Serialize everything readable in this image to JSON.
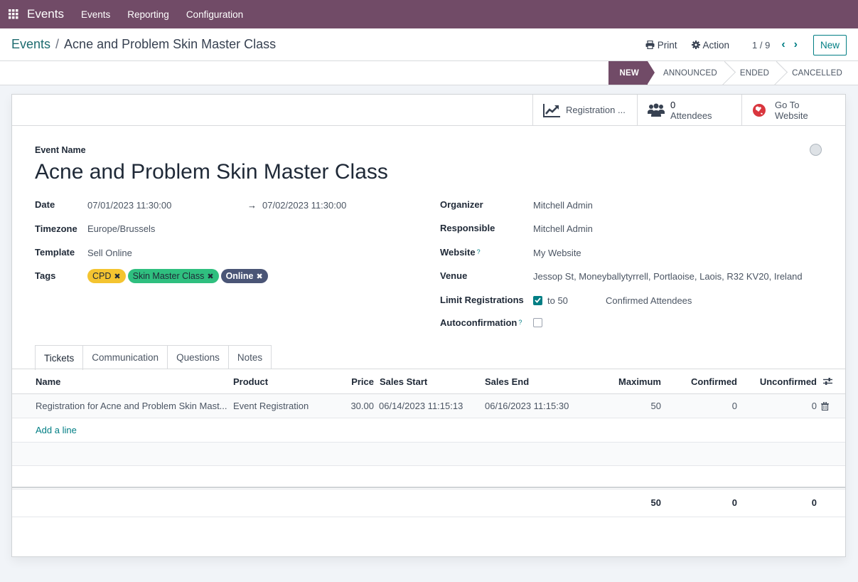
{
  "topnav": {
    "app_name": "Events",
    "menus": [
      "Events",
      "Reporting",
      "Configuration"
    ]
  },
  "control": {
    "breadcrumb_parent": "Events",
    "breadcrumb_separator": "/",
    "breadcrumb_current": "Acne and Problem Skin Master Class",
    "print_label": "Print",
    "action_label": "Action",
    "pager": "1 / 9",
    "new_label": "New"
  },
  "status": {
    "stages": [
      "NEW",
      "ANNOUNCED",
      "ENDED",
      "CANCELLED"
    ],
    "active": "NEW"
  },
  "smart_buttons": {
    "registration_label": "Registration ...",
    "attendees_count": "0",
    "attendees_label": "Attendees",
    "website_line1": "Go To",
    "website_line2": "Website"
  },
  "form": {
    "event_name_label": "Event Name",
    "event_name": "Acne and Problem Skin Master Class",
    "date_label": "Date",
    "date_start": "07/01/2023 11:30:00",
    "date_arrow": "→",
    "date_end": "07/02/2023 11:30:00",
    "timezone_label": "Timezone",
    "timezone": "Europe/Brussels",
    "template_label": "Template",
    "template": "Sell Online",
    "tags_label": "Tags",
    "tags": [
      {
        "label": "CPD",
        "color": "#f4c430",
        "text_color": "#1f2937"
      },
      {
        "label": "Skin Master Class",
        "color": "#2fbf7f",
        "text_color": "#1f2937"
      },
      {
        "label": "Online",
        "color": "#4a5576",
        "text_color": "#ffffff"
      }
    ],
    "organizer_label": "Organizer",
    "organizer": "Mitchell Admin",
    "responsible_label": "Responsible",
    "responsible": "Mitchell Admin",
    "website_label": "Website",
    "website": "My Website",
    "venue_label": "Venue",
    "venue": "Jessop St, Moneyballytyrrell, Portlaoise, Laois, R32 KV20, Ireland",
    "limit_label": "Limit Registrations",
    "limit_checked": true,
    "limit_to": "to 50",
    "limit_suffix": "Confirmed Attendees",
    "autoconfirm_label": "Autoconfirmation",
    "autoconfirm_checked": false,
    "help_mark": "?"
  },
  "tabs": [
    "Tickets",
    "Communication",
    "Questions",
    "Notes"
  ],
  "tickets": {
    "columns": [
      "Name",
      "Product",
      "Price",
      "Sales Start",
      "Sales End",
      "Maximum",
      "Confirmed",
      "Unconfirmed"
    ],
    "rows": [
      {
        "name": "Registration for Acne and Problem Skin Mast...",
        "product": "Event Registration",
        "price": "30.00",
        "sales_start": "06/14/2023 11:15:13",
        "sales_end": "06/16/2023 11:15:30",
        "maximum": "50",
        "confirmed": "0",
        "unconfirmed": "0"
      }
    ],
    "add_line": "Add a line",
    "totals": {
      "maximum": "50",
      "confirmed": "0",
      "unconfirmed": "0"
    }
  },
  "colors": {
    "brand": "#714b67",
    "accent": "#017e84",
    "website_icon": "#d9363e"
  }
}
